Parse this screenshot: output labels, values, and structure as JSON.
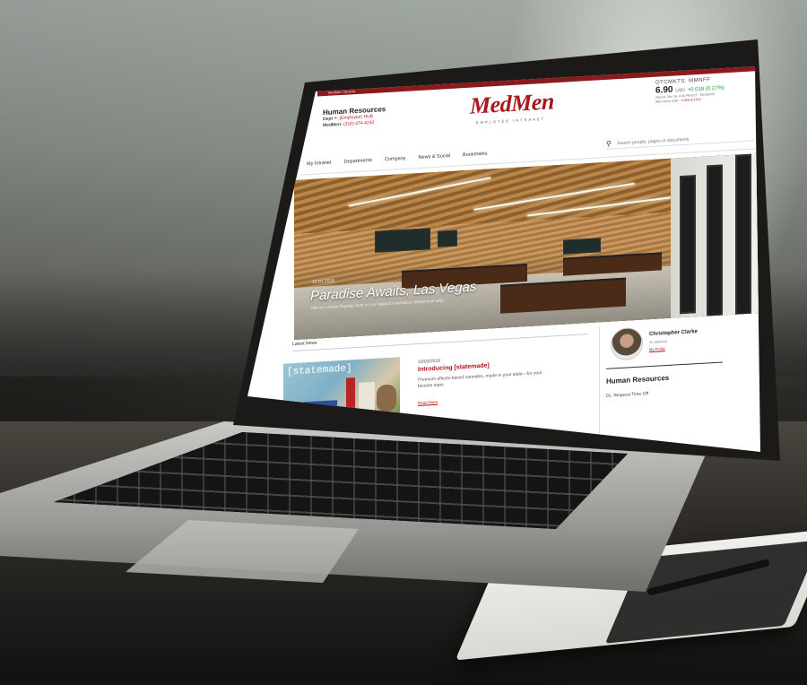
{
  "site": {
    "top_bar_text": "MedMen Intranet",
    "logo": "MedMen",
    "logo_sub": "EMPLOYEE INTRANET"
  },
  "contact": {
    "title": "Human Resources",
    "dept_label": "Dept +:",
    "dept_value": "(Employee) HUB",
    "phone_label": "MedMen:",
    "phone_value": "(310) 474-4242"
  },
  "stock": {
    "symbol": "OTCMKTS: MMNFF",
    "price": "6.90",
    "currency": "USD",
    "change": "+0.018 (0.27%)",
    "meta_line1": "Closed: Dec 16, 4:00 PM EST · Disclaimer",
    "meta_line2": "After hours 6.89 –",
    "meta_line2_change": "0.008 (0.11%)"
  },
  "search": {
    "placeholder": "Search people, pages or documents"
  },
  "nav": {
    "items": [
      "My Intranet",
      "Departments",
      "Company",
      "News & Social",
      "Bookmarks"
    ]
  },
  "hero": {
    "date": "10.01.2018",
    "headline": "Paradise Awaits, Las Vegas",
    "subtext": "Visit our newest flagship store in Las Vegas for exclusive, limited-time offer."
  },
  "latest": {
    "heading": "Latest News",
    "image_tag": "[statemade]",
    "date": "10/03/2019",
    "title": "Introducing [statemade]",
    "description": "Premium effects-based cannabis, made in your state—for your favorite state.",
    "more_link": "Read More"
  },
  "profile": {
    "name": "Christopher Clarke",
    "role": "Sr. Director",
    "link": "My Profile"
  },
  "hr_panel": {
    "title": "Human Resources",
    "first_item": "01. Request Time Off"
  }
}
